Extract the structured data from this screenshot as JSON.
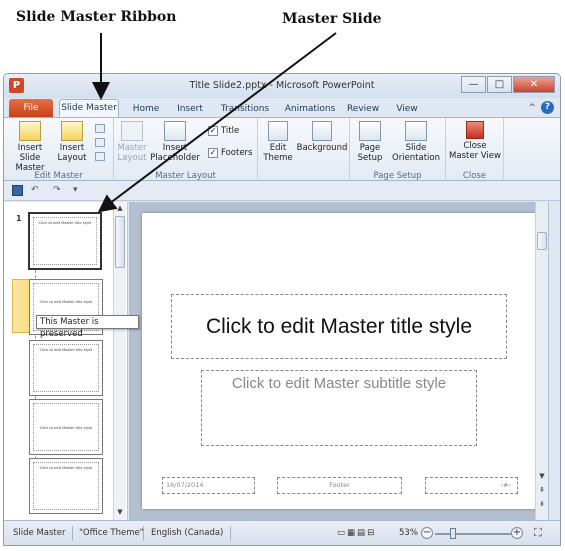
{
  "callouts": {
    "ribbon": "Slide Master Ribbon",
    "master_slide": "Master Slide"
  },
  "window": {
    "app_icon": "P",
    "title": "Title Slide2.pptx - Microsoft PowerPoint",
    "controls": {
      "minimize": "—",
      "maximize": "□",
      "close": "✕"
    }
  },
  "tabs": {
    "file": "File",
    "items": [
      "Slide Master",
      "Home",
      "Insert",
      "Transitions",
      "Animations",
      "Review",
      "View"
    ],
    "active": "Slide Master",
    "collapse_icon": "^",
    "help": "?"
  },
  "ribbon": {
    "edit_master": {
      "label": "Edit Master",
      "insert_slide_master": "Insert Slide Master",
      "insert_layout": "Insert Layout"
    },
    "master_layout": {
      "label": "Master Layout",
      "master_layout_btn": "Master Layout",
      "insert_placeholder": "Insert Placeholder",
      "title_check": "Title",
      "footers_check": "Footers",
      "title_checked": true,
      "footers_checked": true
    },
    "edit_theme": {
      "label": "Edit Theme",
      "edit_theme_btn": "Edit Theme",
      "background_btn": "Background"
    },
    "page_setup": {
      "label": "Page Setup",
      "page_setup_btn": "Page Setup",
      "slide_orientation": "Slide Orientation"
    },
    "close": {
      "label": "Close",
      "close_master_view": "Close Master View"
    }
  },
  "qat": {
    "undo": "↶",
    "redo": "↷",
    "customize": "▾"
  },
  "thumbnails": {
    "master_number": "1",
    "master_title": "Click to edit Master title style",
    "layout_title": "Click to edit Master title style",
    "tooltip": "This Master is preserved"
  },
  "slide": {
    "title": "Click to edit Master title style",
    "subtitle": "Click to edit Master subtitle style",
    "date": "16/07/2014",
    "footer": "Footer",
    "number": "‹#›"
  },
  "status": {
    "view": "Slide Master",
    "theme": "\"Office Theme\"",
    "language": "English (Canada)",
    "zoom": "53%",
    "zoom_fraction": 0.53
  }
}
